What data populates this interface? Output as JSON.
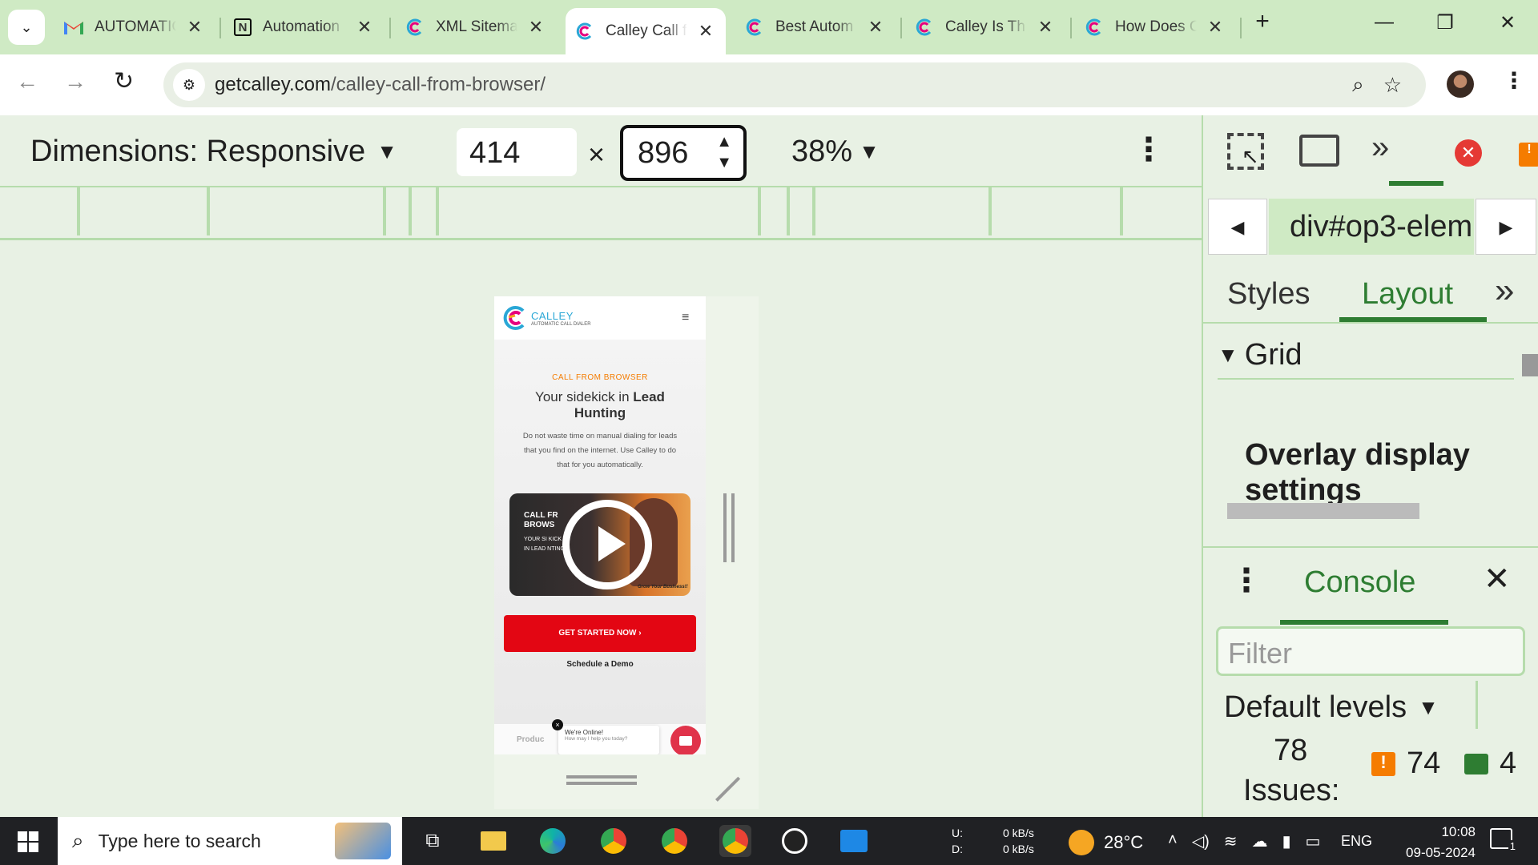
{
  "tabs": [
    {
      "title": "AUTOMATIC",
      "icon": "gmail-icon",
      "active": false
    },
    {
      "title": "Automation",
      "icon": "notion-icon",
      "active": false
    },
    {
      "title": "XML Sitemap",
      "icon": "calley-icon",
      "active": false
    },
    {
      "title": "Calley Call f",
      "icon": "calley-icon",
      "active": true
    },
    {
      "title": "Best Autom",
      "icon": "calley-icon",
      "active": false
    },
    {
      "title": "Calley Is Th",
      "icon": "calley-icon",
      "active": false
    },
    {
      "title": "How Does C",
      "icon": "calley-icon",
      "active": false
    }
  ],
  "address": {
    "domain": "getcalley.com",
    "path": "/calley-call-from-browser/"
  },
  "device_toolbar": {
    "dimensions_label": "Dimensions: Responsive",
    "width": "414",
    "times": "×",
    "height": "896",
    "zoom": "38%"
  },
  "page": {
    "brand": "CALLEY",
    "tagline": "AUTOMATIC CALL DIALER",
    "eyebrow": "CALL FROM BROWSER",
    "headline_pre": "Your sidekick in ",
    "headline_bold": "Lead Hunting",
    "body": "Do not waste time on manual dialing for leads that you find on the internet. Use Calley to do that for you automatically.",
    "video_text_1": "CALL FR",
    "video_text_2": "BROWS",
    "video_text_3": "YOUR SI  KICK",
    "video_text_4": "IN LEAD  NTING",
    "video_caption": "Grow Your Business!!",
    "cta": "GET STARTED NOW  ›",
    "secondary": "Schedule a Demo",
    "chat_title": "We're Online!",
    "chat_sub": "How may I help you today?",
    "footer_fragment": "Produc"
  },
  "devtools": {
    "breadcrumb": "div#op3-elem",
    "tabs": [
      "Styles",
      "Layout"
    ],
    "active_tab": "Layout",
    "section": "Grid",
    "overlay_heading": "Overlay display settings",
    "drawer_tab": "Console",
    "filter_placeholder": "Filter",
    "levels": "Default levels",
    "issue_count": "78",
    "issues_label": "Issues:",
    "warn_count": "74",
    "info_count": "4"
  },
  "taskbar": {
    "search_placeholder": "Type here to search",
    "net_u_label": "U:",
    "net_d_label": "D:",
    "net_u": "0 kB/s",
    "net_d": "0 kB/s",
    "temperature": "28°C",
    "lang": "ENG",
    "time": "10:08",
    "date": "09-05-2024",
    "notif": "1"
  },
  "colors": {
    "tab_strip": "#cfeac4",
    "accent_green": "#2e7d32",
    "cta_red": "#e30613",
    "orange": "#f57c00"
  }
}
